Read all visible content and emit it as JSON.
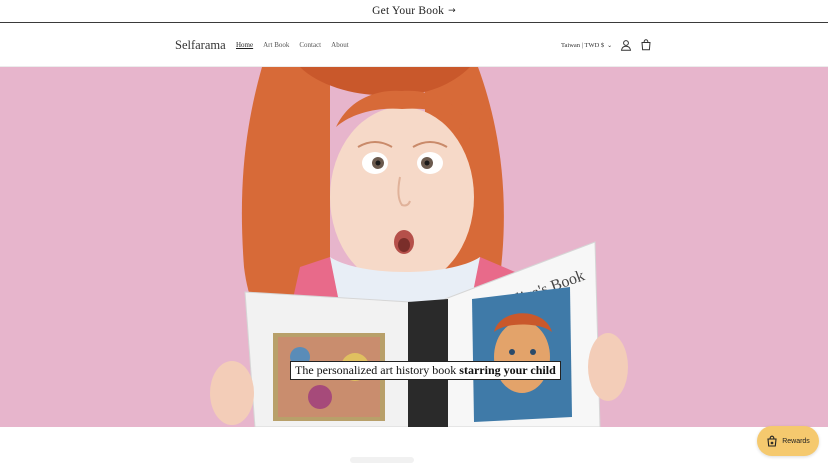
{
  "announcement": {
    "text": "Get Your Book",
    "arrow": "→"
  },
  "header": {
    "logo": "Selfarama",
    "nav": [
      "Home",
      "Art Book",
      "Contact",
      "About"
    ],
    "active_nav": "Home",
    "locale": "Taiwan | TWD $",
    "icons": [
      "account-icon",
      "cart-icon"
    ]
  },
  "hero": {
    "caption_regular": "The personalized art history book",
    "caption_bold": "starring your child",
    "book_title": "Angelica's Book",
    "background_color": "#e7b5cc"
  },
  "rewards": {
    "label": "Rewards",
    "color": "#f5c96e"
  }
}
